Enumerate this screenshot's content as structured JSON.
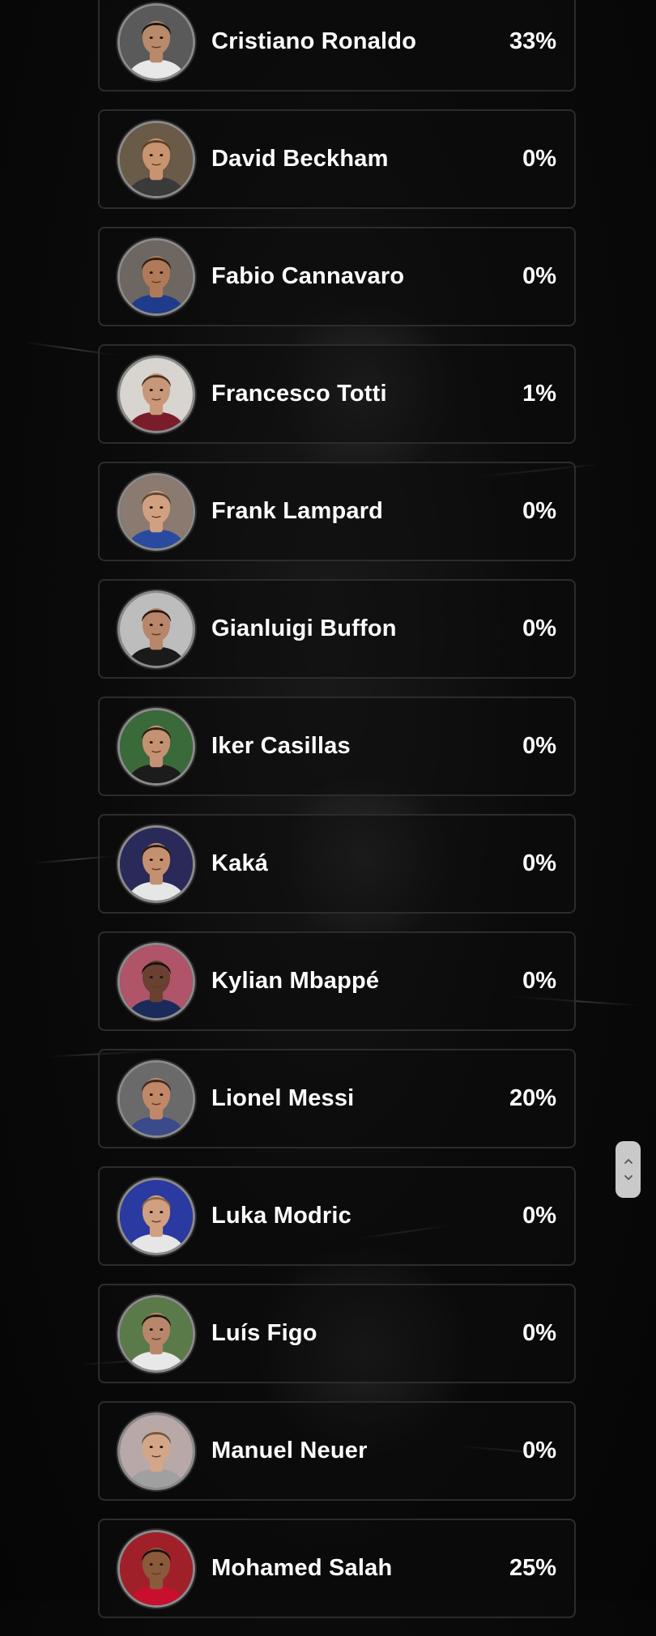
{
  "players": [
    {
      "name": "Cristiano Ronaldo",
      "percent": "33%",
      "icon": "player-portrait",
      "skin": "#b88a6a",
      "hair": "#1a1410",
      "shirt": "#e8e8e8",
      "bg": "#5a5a5a"
    },
    {
      "name": "David Beckham",
      "percent": "0%",
      "icon": "player-portrait",
      "skin": "#c89470",
      "hair": "#5a3f26",
      "shirt": "#3a3a3a",
      "bg": "#6a5a48"
    },
    {
      "name": "Fabio Cannavaro",
      "percent": "0%",
      "icon": "player-portrait",
      "skin": "#b07a58",
      "hair": "#2a2019",
      "shirt": "#1f3c8c",
      "bg": "#6e6660"
    },
    {
      "name": "Francesco Totti",
      "percent": "1%",
      "icon": "player-portrait",
      "skin": "#c8977a",
      "hair": "#4a3220",
      "shirt": "#7a1c2a",
      "bg": "#d8d4d0"
    },
    {
      "name": "Frank Lampard",
      "percent": "0%",
      "icon": "player-portrait",
      "skin": "#d0a080",
      "hair": "#5a4430",
      "shirt": "#2a4aa0",
      "bg": "#8a7a70"
    },
    {
      "name": "Gianluigi Buffon",
      "percent": "0%",
      "icon": "player-portrait",
      "skin": "#b8866a",
      "hair": "#1e1814",
      "shirt": "#1a1a1a",
      "bg": "#bdbdbd"
    },
    {
      "name": "Iker Casillas",
      "percent": "0%",
      "icon": "player-portrait",
      "skin": "#c49272",
      "hair": "#2a1e16",
      "shirt": "#1c1c1c",
      "bg": "#3a6a3a"
    },
    {
      "name": "Kaká",
      "percent": "0%",
      "icon": "player-portrait",
      "skin": "#c49070",
      "hair": "#2a1a12",
      "shirt": "#e6e6e6",
      "bg": "#2a2a5a"
    },
    {
      "name": "Kylian Mbappé",
      "percent": "0%",
      "icon": "player-portrait",
      "skin": "#6a4030",
      "hair": "#141010",
      "shirt": "#1a2a5a",
      "bg": "#b0546a"
    },
    {
      "name": "Lionel Messi",
      "percent": "20%",
      "icon": "player-portrait",
      "skin": "#c08868",
      "hair": "#3a2a1c",
      "shirt": "#3a4a8a",
      "bg": "#6a6a6a"
    },
    {
      "name": "Luka Modric",
      "percent": "0%",
      "icon": "player-portrait",
      "skin": "#d0a080",
      "hair": "#8a6a40",
      "shirt": "#e6e6e6",
      "bg": "#2a3aa0"
    },
    {
      "name": "Luís Figo",
      "percent": "0%",
      "icon": "player-portrait",
      "skin": "#b8866a",
      "hair": "#1e1814",
      "shirt": "#e8e8e8",
      "bg": "#5a7a4a"
    },
    {
      "name": "Manuel Neuer",
      "percent": "0%",
      "icon": "player-portrait",
      "skin": "#d4a688",
      "hair": "#6a5a48",
      "shirt": "#a0a0a0",
      "bg": "#b8a8a8"
    },
    {
      "name": "Mohamed Salah",
      "percent": "25%",
      "icon": "player-portrait",
      "skin": "#8a5a3a",
      "hair": "#141010",
      "shirt": "#c8102e",
      "bg": "#a0202a"
    }
  ],
  "scroll_widget": {
    "up_icon": "chevron-up-icon",
    "down_icon": "chevron-down-icon"
  }
}
